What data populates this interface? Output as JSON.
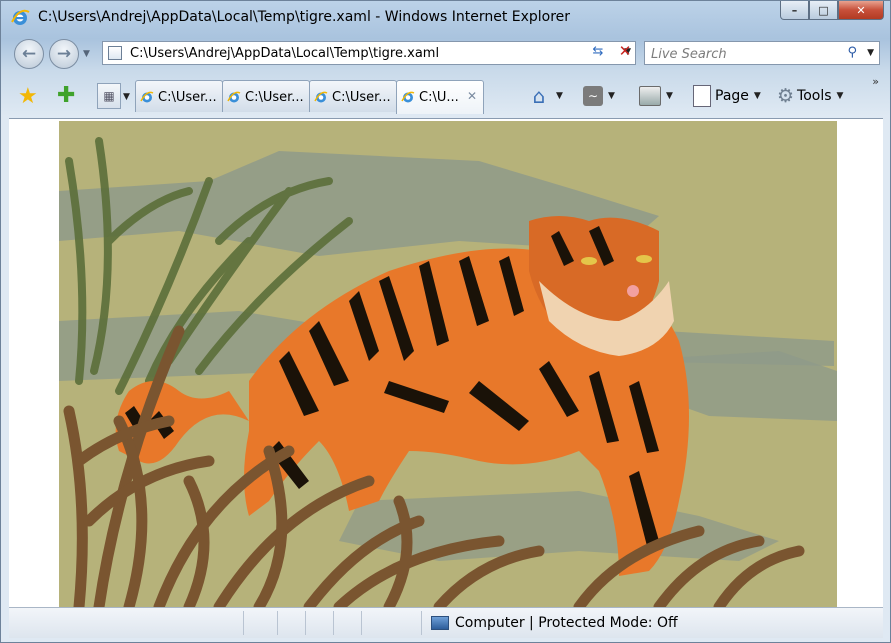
{
  "window": {
    "title": "C:\\Users\\Andrej\\AppData\\Local\\Temp\\tigre.xaml - Windows Internet Explorer",
    "minimize_label": "–",
    "maximize_label": "□",
    "close_label": "✕"
  },
  "address": {
    "url": "C:\\Users\\Andrej\\AppData\\Local\\Temp\\tigre.xaml",
    "search_placeholder": "Live Search"
  },
  "tabs": [
    {
      "label": "C:\\User...",
      "active": false
    },
    {
      "label": "C:\\User...",
      "active": false
    },
    {
      "label": "C:\\User...",
      "active": false
    },
    {
      "label": "C:\\U...",
      "active": true
    }
  ],
  "toolbar": {
    "page_label": "Page",
    "tools_label": "Tools",
    "overflow": "»"
  },
  "content": {
    "image": "tiger-in-grass-illustration"
  },
  "status": {
    "zone_text": "Computer | Protected Mode: Off"
  },
  "colors": {
    "background_khaki": "#b6b27a",
    "tiger_orange": "#e8782a",
    "grass_brown": "#7a5530",
    "shadow_gray": "#8f9a8a"
  }
}
